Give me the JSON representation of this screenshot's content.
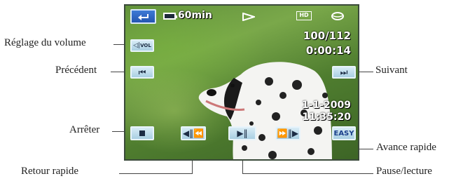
{
  "callouts": {
    "volume": "Réglage du volume",
    "previous": "Précédent",
    "next": "Suivant",
    "stop": "Arrêter",
    "fast_forward": "Avance rapide",
    "rewind": "Retour rapide",
    "play_pause": "Pause/lecture"
  },
  "screen": {
    "battery_time": "60min",
    "quality": "HD",
    "counter": "100/112",
    "elapsed": "0:00:14",
    "date": "1-1-2009",
    "time": "11:35:20",
    "easy_label": "EASY",
    "vol_label": "VOL"
  },
  "colors": {
    "button_fill": "#b8dcee",
    "button_border": "#e8f4fb",
    "return_button": "#2a64c8"
  }
}
